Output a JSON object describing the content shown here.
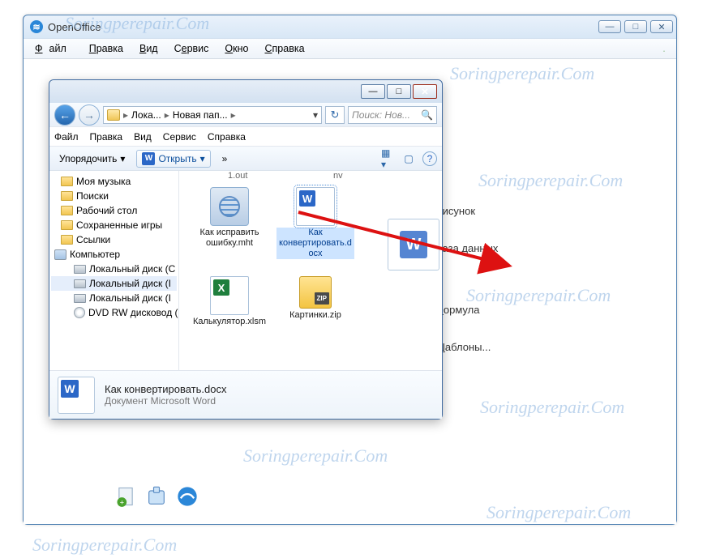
{
  "watermark_text": "Soringperepair.Com",
  "oo": {
    "title": "OpenOffice",
    "menu": [
      "Файл",
      "Правка",
      "Вид",
      "Сервис",
      "Окно",
      "Справка"
    ],
    "menu_hotkeys": [
      "Ф",
      "П",
      "В",
      "е",
      "О",
      "С"
    ],
    "start_center": {
      "risunok": "Рисунок",
      "baza": "База данных",
      "formula": "Формула",
      "shablony": "Шаблоны..."
    }
  },
  "explorer": {
    "breadcrumb": {
      "part1": "Лока...",
      "part2": "Новая пап...",
      "sep": "▸"
    },
    "search_placeholder": "Поиск: Нов...",
    "menu": [
      "Файл",
      "Правка",
      "Вид",
      "Сервис",
      "Справка"
    ],
    "toolbar": {
      "organize": "Упорядочить",
      "open": "Открыть",
      "dd": "▾"
    },
    "tree": {
      "items": [
        {
          "kind": "fld",
          "label": "Моя музыка"
        },
        {
          "kind": "fld",
          "label": "Поиски"
        },
        {
          "kind": "fld",
          "label": "Рабочий стол"
        },
        {
          "kind": "fld",
          "label": "Сохраненные игры"
        },
        {
          "kind": "fld",
          "label": "Ссылки"
        },
        {
          "kind": "comp",
          "label": "Компьютер"
        },
        {
          "kind": "disk",
          "label": "Локальный диск (C"
        },
        {
          "kind": "disk",
          "label": "Локальный диск (I",
          "sel": true
        },
        {
          "kind": "disk",
          "label": "Локальный диск (I"
        },
        {
          "kind": "dvd",
          "label": "DVD RW дисковод ("
        }
      ],
      "trunc_top": "1.out",
      "trunc_top_right": "nv"
    },
    "files": {
      "mht": "Как исправить ошибку.mht",
      "docx": "Как конвертировать.docx",
      "xlsm": "Калькулятор.xlsm",
      "zip": "Картинки.zip"
    },
    "status": {
      "filename": "Как конвертировать.docx",
      "filetype": "Документ Microsoft Word"
    }
  }
}
